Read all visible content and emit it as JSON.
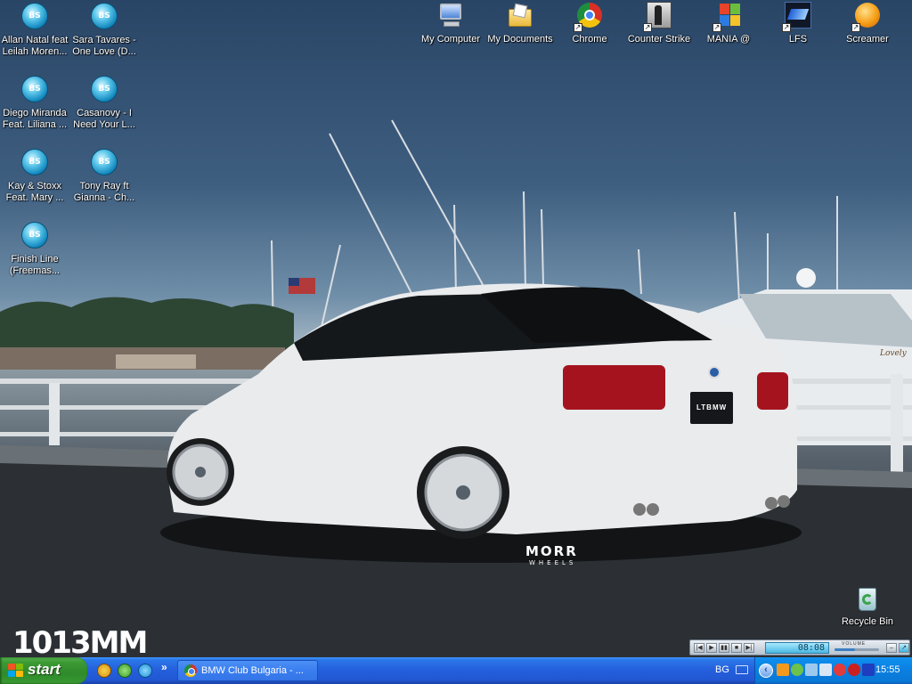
{
  "desktop": {
    "icons_left": [
      {
        "label_line1": "Allan Natal feat",
        "label_line2": "Leilah Moren...",
        "icon": "bsplayer-icon"
      },
      {
        "label_line1": "Sara Tavares -",
        "label_line2": "One Love (D...",
        "icon": "bsplayer-icon"
      },
      {
        "label_line1": "Diego Miranda",
        "label_line2": "Feat. Liliana ...",
        "icon": "bsplayer-icon"
      },
      {
        "label_line1": "Casanovy - I",
        "label_line2": "Need Your L...",
        "icon": "bsplayer-icon"
      },
      {
        "label_line1": "Kay & Stoxx",
        "label_line2": "Feat. Mary ...",
        "icon": "bsplayer-icon"
      },
      {
        "label_line1": "Tony Ray ft",
        "label_line2": "Gianna - Ch...",
        "icon": "bsplayer-icon"
      },
      {
        "label_line1": "Finish Line",
        "label_line2": "(Freemas...",
        "icon": "bsplayer-icon"
      }
    ],
    "bsplayer_glyph": "BS",
    "icons_top": [
      {
        "label": "My Computer",
        "icon": "my-computer-icon"
      },
      {
        "label": "My  Documents",
        "icon": "my-documents-icon"
      },
      {
        "label": "Chrome",
        "icon": "chrome-icon"
      },
      {
        "label": "Counter Strike",
        "icon": "counter-strike-icon"
      },
      {
        "label": "MANIA @",
        "icon": "mania-icon"
      },
      {
        "label": "LFS",
        "icon": "lfs-icon"
      },
      {
        "label": "Screamer",
        "icon": "screamer-icon"
      }
    ],
    "recycle_bin_label": "Recycle Bin",
    "wallpaper": {
      "watermark": "1013MM",
      "plate_text": "LTBMW",
      "wheel_brand": "MORR",
      "wheel_sub": "WHEELS",
      "boat_name": "Lovely"
    }
  },
  "media_player": {
    "time": "08:08",
    "volume_label": "VOLUME",
    "volume_level": 0.45
  },
  "taskbar": {
    "start_label": "start",
    "quick_launch": [
      "chrome-icon",
      "utorrent-icon",
      "skype-icon"
    ],
    "overflow_glyph": "»",
    "active_window": "BMW Club Bulgaria - ...",
    "language": "BG",
    "tray_icons": [
      "winamp-icon",
      "utorrent-tray-icon",
      "network-icon",
      "volume-icon",
      "antivirus-icon",
      "opera-icon",
      "media-icon"
    ],
    "clock": "15:55"
  },
  "colors": {
    "taskbar_blue": "#245edb",
    "start_green": "#3c9a34",
    "tray_blue": "#0b7fe0"
  }
}
